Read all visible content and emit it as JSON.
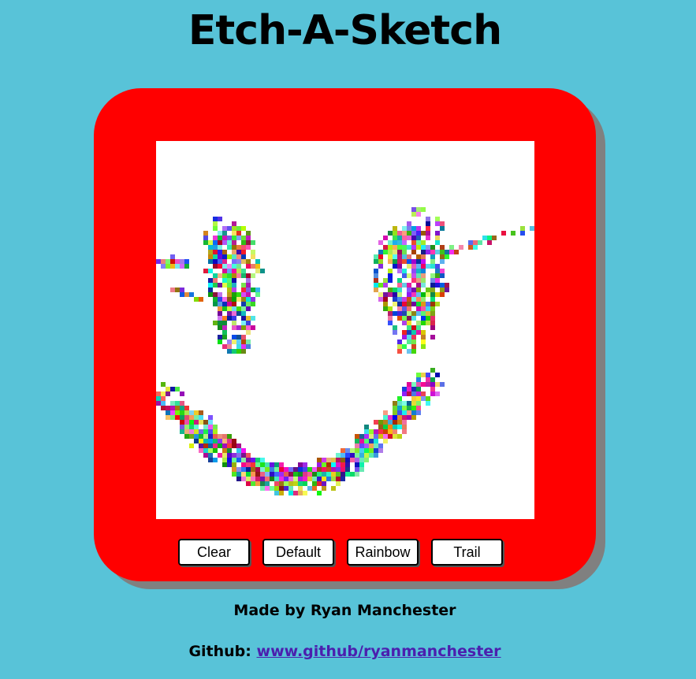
{
  "title": "Etch-A-Sketch",
  "colors": {
    "background": "#58c3d8",
    "frame": "#ff0000",
    "frame_shadow": "#808080",
    "canvas": "#ffffff",
    "link": "#4b1fae"
  },
  "controls": {
    "clear_label": "Clear",
    "default_label": "Default",
    "rainbow_label": "Rainbow",
    "trail_label": "Trail"
  },
  "footer": {
    "made_by": "Made by Ryan Manchester",
    "github_label": "Github:",
    "github_link_text": "www.github/ryanmanchester"
  },
  "drawing": {
    "mode": "rainbow",
    "content": "smiley face drawn with multicolored pixels"
  }
}
